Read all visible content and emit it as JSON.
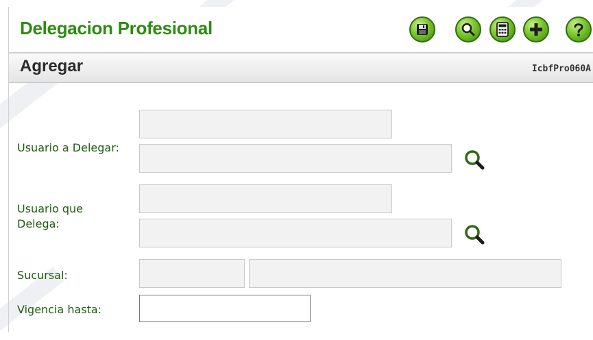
{
  "header": {
    "title": "Delegacion Profesional",
    "toolbar": [
      {
        "name": "save-icon",
        "icon": "floppy-disk"
      },
      {
        "name": "search-icon",
        "icon": "magnifier"
      },
      {
        "name": "calculator-icon",
        "icon": "calculator"
      },
      {
        "name": "add-icon",
        "icon": "plus"
      },
      {
        "name": "help-icon",
        "icon": "question-mark"
      }
    ]
  },
  "subheader": {
    "title": "Agregar",
    "form_code": "IcbfPro060A"
  },
  "form": {
    "usuario_delegar_label": "Usuario a Delegar:",
    "usuario_delega_label_line1": "Usuario que",
    "usuario_delega_label_line2": "Delega:",
    "sucursal_label": "Sucursal:",
    "vigencia_label": "Vigencia hasta:",
    "usuario_delegar_code": "",
    "usuario_delegar_name": "",
    "usuario_delega_code": "",
    "usuario_delega_name": "",
    "sucursal_code": "",
    "sucursal_name": "",
    "vigencia_hasta": ""
  },
  "colors": {
    "title_green": "#2e8b12",
    "label_green": "#1e5d10",
    "button_green": "#7bc52a"
  }
}
